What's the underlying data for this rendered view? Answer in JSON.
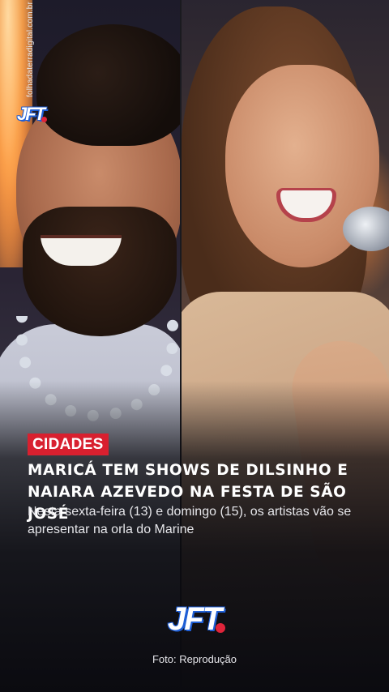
{
  "watermark": {
    "site": "folhadaterradigital.com.br",
    "logo": "JFT"
  },
  "article": {
    "category": "CIDADES",
    "headline_line1": "MARICÁ TEM SHOWS DE DILSINHO E",
    "headline_line2": "NAIARA AZEVEDO NA FESTA DE SÃO JOSÉ",
    "subtitle_line1": "Nesta sexta-feira (13) e domingo (15), os artistas vão se",
    "subtitle_line2": "apresentar na orla do Marine"
  },
  "footer": {
    "logo": "JFT",
    "photo_credit": "Foto: Reprodução"
  },
  "colors": {
    "badge": "#d8202f",
    "logo_outline": "#1f5fd6",
    "logo_dot": "#e0243a",
    "background": "#0b0b10"
  }
}
